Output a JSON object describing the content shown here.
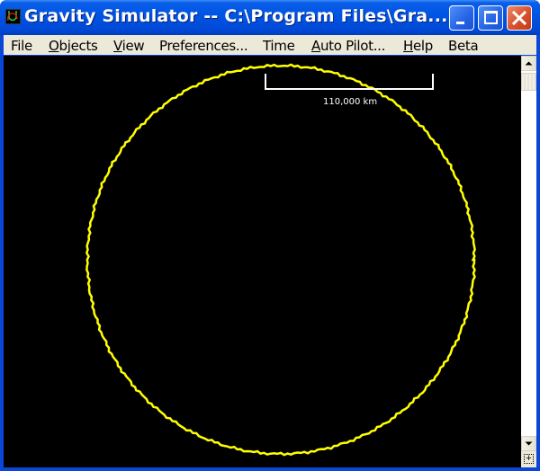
{
  "window": {
    "title": "Gravity Simulator -- C:\\Program Files\\Gra...",
    "buttons": {
      "minimize": "minimize",
      "maximize": "maximize",
      "close": "close"
    }
  },
  "menubar": {
    "items": [
      {
        "label": "File",
        "underline": ""
      },
      {
        "label": "Objects",
        "underline": "O"
      },
      {
        "label": "View",
        "underline": "V"
      },
      {
        "label": "Preferences...",
        "underline": ""
      },
      {
        "label": "Time",
        "underline": ""
      },
      {
        "label": "Auto Pilot...",
        "underline": "A"
      },
      {
        "label": "Help",
        "underline": "H"
      },
      {
        "label": "Beta",
        "underline": ""
      }
    ]
  },
  "simulation": {
    "scale_bar_label": "110,000  km",
    "orbit_color": "#ffff00",
    "background_color": "#000000",
    "scale_bar_color": "#ffffff"
  },
  "scrollbar": {
    "up_icon": "arrow-up",
    "down_icon": "arrow-down",
    "corner_icon": "move-crosshair"
  }
}
